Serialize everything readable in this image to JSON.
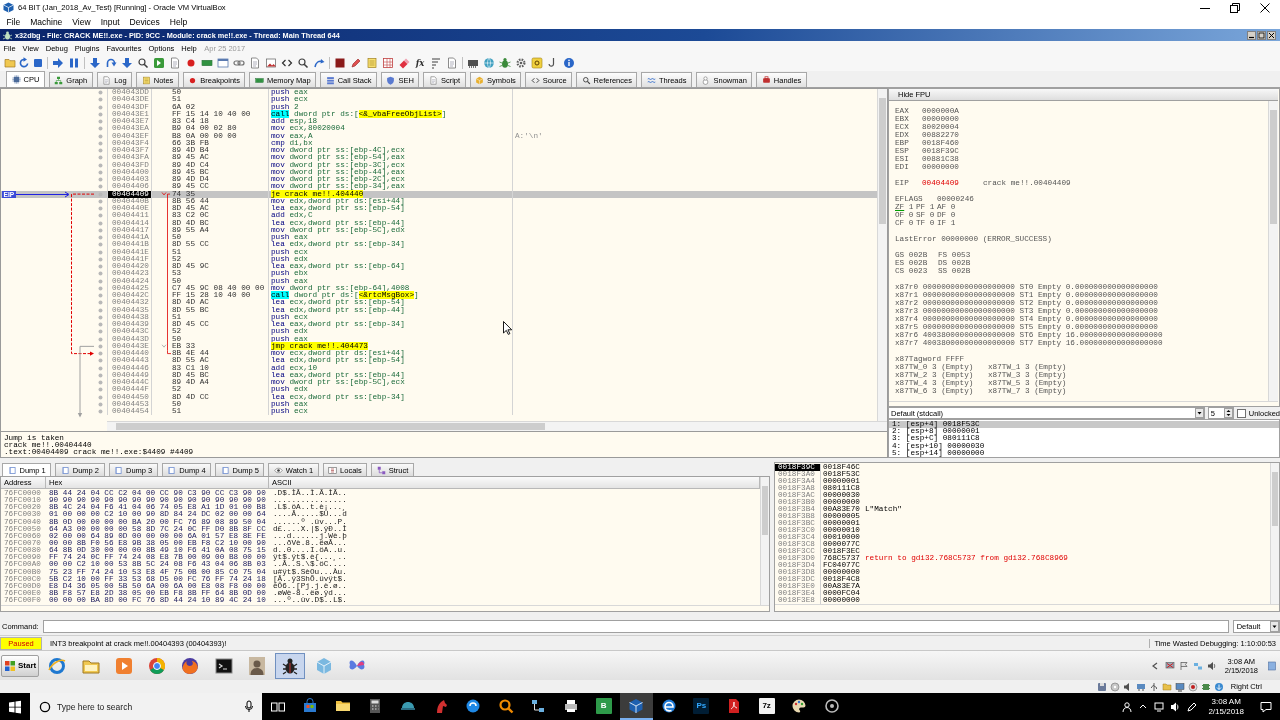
{
  "vbox": {
    "title": "64 BIT (Jan_2018_Av_Test) [Running] - Oracle VM VirtualBox",
    "menu": [
      "File",
      "Machine",
      "View",
      "Input",
      "Devices",
      "Help"
    ]
  },
  "debugger": {
    "title": "x32dbg - File: CRACK ME!!.exe - PID: 9CC - Module: crack me!!.exe - Thread: Main Thread 644",
    "menu": [
      "File",
      "View",
      "Debug",
      "Plugins",
      "Favourites",
      "Options",
      "Help"
    ],
    "build_date": "Apr 25 2017",
    "toolbar": {
      "text_buttons": [
        "fx"
      ]
    },
    "tabs": [
      {
        "label": "CPU",
        "selected": true
      },
      {
        "label": "Graph",
        "selected": false
      },
      {
        "label": "Log",
        "selected": false
      },
      {
        "label": "Notes",
        "selected": false
      },
      {
        "label": "Breakpoints",
        "selected": false
      },
      {
        "label": "Memory Map",
        "selected": false
      },
      {
        "label": "Call Stack",
        "selected": false
      },
      {
        "label": "SEH",
        "selected": false
      },
      {
        "label": "Script",
        "selected": false
      },
      {
        "label": "Symbols",
        "selected": false
      },
      {
        "label": "Source",
        "selected": false
      },
      {
        "label": "References",
        "selected": false
      },
      {
        "label": "Threads",
        "selected": false
      },
      {
        "label": "Snowman",
        "selected": false
      },
      {
        "label": "Handles",
        "selected": false
      }
    ],
    "disassembly": {
      "eip_label": "EIP",
      "rows": [
        {
          "address": "004043DD",
          "bytes": "50",
          "mnemonic": "push",
          "operands": "eax",
          "kind": "plain",
          "selected": false,
          "jump_target": false
        },
        {
          "address": "004043DE",
          "bytes": "51",
          "mnemonic": "push",
          "operands": "ecx",
          "kind": "plain",
          "selected": false,
          "jump_target": false
        },
        {
          "address": "004043DF",
          "bytes": "6A 02",
          "mnemonic": "push",
          "operands": "2",
          "kind": "plain",
          "selected": false,
          "jump_target": false
        },
        {
          "address": "004043E1",
          "bytes": "FF 15 14 10 40 00",
          "mnemonic": "call",
          "operands": "dword ptr ds:[",
          "target": "<&_vbaFreeObjList>",
          "operands_end": "]",
          "kind": "call",
          "selected": false,
          "jump_target": false
        },
        {
          "address": "004043E7",
          "bytes": "83 C4 18",
          "mnemonic": "add",
          "operands": "esp,18",
          "kind": "plain",
          "selected": false,
          "jump_target": false
        },
        {
          "address": "004043EA",
          "bytes": "B9 04 00 02 80",
          "mnemonic": "mov",
          "operands": "ecx,80020004",
          "kind": "plain",
          "selected": false,
          "jump_target": false
        },
        {
          "address": "004043EF",
          "bytes": "B8 0A 00 00 00",
          "mnemonic": "mov",
          "operands": "eax,A",
          "comment": "A:'\\n'",
          "kind": "plain",
          "selected": false,
          "jump_target": false
        },
        {
          "address": "004043F4",
          "bytes": "66 3B FB",
          "mnemonic": "cmp",
          "operands": "di,bx",
          "kind": "plain",
          "selected": false,
          "jump_target": false
        },
        {
          "address": "004043F7",
          "bytes": "89 4D B4",
          "mnemonic": "mov",
          "operands": "dword ptr ss:[ebp-4C],ecx",
          "kind": "plain",
          "selected": false,
          "jump_target": false
        },
        {
          "address": "004043FA",
          "bytes": "89 45 AC",
          "mnemonic": "mov",
          "operands": "dword ptr ss:[ebp-54],eax",
          "kind": "plain",
          "selected": false,
          "jump_target": false
        },
        {
          "address": "004043FD",
          "bytes": "89 4D C4",
          "mnemonic": "mov",
          "operands": "dword ptr ss:[ebp-3C],ecx",
          "kind": "plain",
          "selected": false,
          "jump_target": false
        },
        {
          "address": "00404400",
          "bytes": "89 45 BC",
          "mnemonic": "mov",
          "operands": "dword ptr ss:[ebp-44],eax",
          "kind": "plain",
          "selected": false,
          "jump_target": false
        },
        {
          "address": "00404403",
          "bytes": "89 4D D4",
          "mnemonic": "mov",
          "operands": "dword ptr ss:[ebp-2C],ecx",
          "kind": "plain",
          "selected": false,
          "jump_target": false
        },
        {
          "address": "00404406",
          "bytes": "89 45 CC",
          "mnemonic": "mov",
          "operands": "dword ptr ss:[ebp-34],eax",
          "kind": "plain",
          "selected": false,
          "jump_target": false
        },
        {
          "address": "00404409",
          "bytes": "74 35",
          "mnemonic": "je",
          "operands": "crack me!!.404440",
          "kind": "jump",
          "taken": true,
          "selected": true,
          "jump_target": false
        },
        {
          "address": "0040440B",
          "bytes": "8B 56 44",
          "mnemonic": "mov",
          "operands": "edx,dword ptr ds:[esi+44]",
          "kind": "plain",
          "selected": false,
          "jump_target": false
        },
        {
          "address": "0040440E",
          "bytes": "8D 45 AC",
          "mnemonic": "lea",
          "operands": "eax,dword ptr ss:[ebp-54]",
          "kind": "plain",
          "selected": false,
          "jump_target": false
        },
        {
          "address": "00404411",
          "bytes": "83 C2 0C",
          "mnemonic": "add",
          "operands": "edx,C",
          "kind": "plain",
          "selected": false,
          "jump_target": false
        },
        {
          "address": "00404414",
          "bytes": "8D 4D BC",
          "mnemonic": "lea",
          "operands": "ecx,dword ptr ss:[ebp-44]",
          "kind": "plain",
          "selected": false,
          "jump_target": false
        },
        {
          "address": "00404417",
          "bytes": "89 55 A4",
          "mnemonic": "mov",
          "operands": "dword ptr ss:[ebp-5C],edx",
          "kind": "plain",
          "selected": false,
          "jump_target": false
        },
        {
          "address": "0040441A",
          "bytes": "50",
          "mnemonic": "push",
          "operands": "eax",
          "kind": "plain",
          "selected": false,
          "jump_target": false
        },
        {
          "address": "0040441B",
          "bytes": "8D 55 CC",
          "mnemonic": "lea",
          "operands": "edx,dword ptr ss:[ebp-34]",
          "kind": "plain",
          "selected": false,
          "jump_target": false
        },
        {
          "address": "0040441E",
          "bytes": "51",
          "mnemonic": "push",
          "operands": "ecx",
          "kind": "plain",
          "selected": false,
          "jump_target": false
        },
        {
          "address": "0040441F",
          "bytes": "52",
          "mnemonic": "push",
          "operands": "edx",
          "kind": "plain",
          "selected": false,
          "jump_target": false
        },
        {
          "address": "00404420",
          "bytes": "8D 45 9C",
          "mnemonic": "lea",
          "operands": "eax,dword ptr ss:[ebp-64]",
          "kind": "plain",
          "selected": false,
          "jump_target": false
        },
        {
          "address": "00404423",
          "bytes": "53",
          "mnemonic": "push",
          "operands": "ebx",
          "kind": "plain",
          "selected": false,
          "jump_target": false
        },
        {
          "address": "00404424",
          "bytes": "50",
          "mnemonic": "push",
          "operands": "eax",
          "kind": "plain",
          "selected": false,
          "jump_target": false
        },
        {
          "address": "00404425",
          "bytes": "C7 45 9C 08 40 00 00",
          "mnemonic": "mov",
          "operands": "dword ptr ss:[ebp-64],4008",
          "kind": "plain",
          "selected": false,
          "jump_target": false
        },
        {
          "address": "0040442C",
          "bytes": "FF 15 28 10 40 00",
          "mnemonic": "call",
          "operands": "dword ptr ds:[",
          "target": "<&rtcMsgBox>",
          "operands_end": "]",
          "kind": "call",
          "selected": false,
          "jump_target": false
        },
        {
          "address": "00404432",
          "bytes": "8D 4D AC",
          "mnemonic": "lea",
          "operands": "ecx,dword ptr ss:[ebp-54]",
          "kind": "plain",
          "selected": false,
          "jump_target": false
        },
        {
          "address": "00404435",
          "bytes": "8D 55 BC",
          "mnemonic": "lea",
          "operands": "edx,dword ptr ss:[ebp-44]",
          "kind": "plain",
          "selected": false,
          "jump_target": false
        },
        {
          "address": "00404438",
          "bytes": "51",
          "mnemonic": "push",
          "operands": "ecx",
          "kind": "plain",
          "selected": false,
          "jump_target": false
        },
        {
          "address": "00404439",
          "bytes": "8D 45 CC",
          "mnemonic": "lea",
          "operands": "eax,dword ptr ss:[ebp-34]",
          "kind": "plain",
          "selected": false,
          "jump_target": false
        },
        {
          "address": "0040443C",
          "bytes": "52",
          "mnemonic": "push",
          "operands": "edx",
          "kind": "plain",
          "selected": false,
          "jump_target": false
        },
        {
          "address": "0040443D",
          "bytes": "50",
          "mnemonic": "push",
          "operands": "eax",
          "kind": "plain",
          "selected": false,
          "jump_target": false
        },
        {
          "address": "0040443E",
          "bytes": "EB 33",
          "mnemonic": "jmp",
          "operands": "crack me!!.404473",
          "kind": "jump",
          "taken": false,
          "selected": false,
          "jump_target": false
        },
        {
          "address": "00404440",
          "bytes": "8B 4E 44",
          "mnemonic": "mov",
          "operands": "ecx,dword ptr ds:[esi+44]",
          "kind": "plain",
          "selected": false,
          "jump_target": true
        },
        {
          "address": "00404443",
          "bytes": "8D 55 AC",
          "mnemonic": "lea",
          "operands": "edx,dword ptr ss:[ebp-54]",
          "kind": "plain",
          "selected": false,
          "jump_target": false
        },
        {
          "address": "00404446",
          "bytes": "83 C1 10",
          "mnemonic": "add",
          "operands": "ecx,10",
          "kind": "plain",
          "selected": false,
          "jump_target": false
        },
        {
          "address": "00404449",
          "bytes": "8D 45 BC",
          "mnemonic": "lea",
          "operands": "eax,dword ptr ss:[ebp-44]",
          "kind": "plain",
          "selected": false,
          "jump_target": false
        },
        {
          "address": "0040444C",
          "bytes": "89 4D A4",
          "mnemonic": "mov",
          "operands": "dword ptr ss:[ebp-5C],ecx",
          "kind": "plain",
          "selected": false,
          "jump_target": false
        },
        {
          "address": "0040444F",
          "bytes": "52",
          "mnemonic": "push",
          "operands": "edx",
          "kind": "plain",
          "selected": false,
          "jump_target": false
        },
        {
          "address": "00404450",
          "bytes": "8D 4D CC",
          "mnemonic": "lea",
          "operands": "ecx,dword ptr ss:[ebp-34]",
          "kind": "plain",
          "selected": false,
          "jump_target": false
        },
        {
          "address": "00404453",
          "bytes": "50",
          "mnemonic": "push",
          "operands": "eax",
          "kind": "plain",
          "selected": false,
          "jump_target": false
        },
        {
          "address": "00404454",
          "bytes": "51",
          "mnemonic": "push",
          "operands": "ecx",
          "kind": "plain",
          "selected": false,
          "jump_target": false
        }
      ]
    },
    "jump_info": [
      "Jump is taken",
      "crack me!!.00404440",
      ".text:00404409 crack me!!.exe:$4409 #4409"
    ],
    "registers": {
      "header": "Hide FPU",
      "general": [
        {
          "name": "EAX",
          "value": "0000000A",
          "changed": false
        },
        {
          "name": "EBX",
          "value": "00000000",
          "changed": false
        },
        {
          "name": "ECX",
          "value": "80020004",
          "changed": false
        },
        {
          "name": "EDX",
          "value": "00882270",
          "changed": false
        },
        {
          "name": "EBP",
          "value": "0018F460",
          "changed": false
        },
        {
          "name": "ESP",
          "value": "0018F39C",
          "changed": false
        },
        {
          "name": "ESI",
          "value": "00881C38",
          "changed": false
        },
        {
          "name": "EDI",
          "value": "00000000",
          "changed": false
        }
      ],
      "eip": {
        "name": "EIP",
        "value": "00404409",
        "changed": true,
        "comment": "crack me!!.00404409"
      },
      "eflags": {
        "name": "EFLAGS",
        "value": "00000246"
      },
      "flag_rows": [
        {
          "flags": [
            {
              "name": "ZF",
              "value": "1",
              "highlighted": true
            },
            {
              "name": "PF",
              "value": "1",
              "highlighted": false
            },
            {
              "name": "AF",
              "value": "0",
              "highlighted": false
            }
          ]
        },
        {
          "flags": [
            {
              "name": "OF",
              "value": "0",
              "highlighted": false
            },
            {
              "name": "SF",
              "value": "0",
              "highlighted": false
            },
            {
              "name": "DF",
              "value": "0",
              "highlighted": false
            }
          ]
        },
        {
          "flags": [
            {
              "name": "CF",
              "value": "0",
              "highlighted": false
            },
            {
              "name": "TF",
              "value": "0",
              "highlighted": false
            },
            {
              "name": "IF",
              "value": "1",
              "highlighted": false
            }
          ]
        }
      ],
      "last_error": "LastError 00000000 (ERROR_SUCCESS)",
      "segment_rows": [
        {
          "segments": [
            {
              "name": "GS",
              "value": "002B"
            },
            {
              "name": "FS",
              "value": "0053"
            }
          ]
        },
        {
          "segments": [
            {
              "name": "ES",
              "value": "002B"
            },
            {
              "name": "DS",
              "value": "002B"
            }
          ]
        },
        {
          "segments": [
            {
              "name": "CS",
              "value": "0023"
            },
            {
              "name": "SS",
              "value": "002B"
            }
          ]
        }
      ],
      "fpu": [
        "x87r0 00000000000000000000 ST0 Empty 0.000000000000000000",
        "x87r1 00000000000000000000 ST1 Empty 0.000000000000000000",
        "x87r2 00000000000000000000 ST2 Empty 0.000000000000000000",
        "x87r3 00000000000000000000 ST3 Empty 0.000000000000000000",
        "x87r4 00000000000000000000 ST4 Empty 0.000000000000000000",
        "x87r5 00000000000000000000 ST5 Empty 0.000000000000000000",
        "x87r6 40038000000000000000 ST6 Empty 16.000000000000000000",
        "x87r7 40038000000000000000 ST7 Empty 16.000000000000000000"
      ],
      "tagword": "x87Tagword FFFF",
      "tag_rows": [
        {
          "tags": [
            "x87TW_0 3 (Empty)",
            "x87TW_1 3 (Empty)"
          ]
        },
        {
          "tags": [
            "x87TW_2 3 (Empty)",
            "x87TW_3 3 (Empty)"
          ]
        },
        {
          "tags": [
            "x87TW_4 3 (Empty)",
            "x87TW_5 3 (Empty)"
          ]
        },
        {
          "tags": [
            "x87TW_6 3 (Empty)",
            "x87TW_7 3 (Empty)"
          ]
        }
      ]
    },
    "arguments": {
      "convention": "Default (stdcall)",
      "count": "5",
      "unlocked": {
        "label": "Unlocked",
        "checked": false
      },
      "rows": [
        {
          "text": "1: [esp+4] 0018F53C",
          "selected": true
        },
        {
          "text": "2: [esp+8] 00000001",
          "selected": false
        },
        {
          "text": "3: [esp+C] 080111C8",
          "selected": false
        },
        {
          "text": "4: [esp+10] 00000030",
          "selected": false
        },
        {
          "text": "5: [esp+14] 00000000",
          "selected": false
        }
      ]
    },
    "dump": {
      "tabs": [
        {
          "label": "Dump 1",
          "selected": true
        },
        {
          "label": "Dump 2",
          "selected": false
        },
        {
          "label": "Dump 3",
          "selected": false
        },
        {
          "label": "Dump 4",
          "selected": false
        },
        {
          "label": "Dump 5",
          "selected": false
        },
        {
          "label": "Watch 1",
          "selected": false
        },
        {
          "label": "Locals",
          "selected": false
        },
        {
          "label": "Struct",
          "selected": false
        }
      ],
      "columns": [
        "Address",
        "Hex",
        "ASCII"
      ],
      "rows": [
        {
          "address": "76FC0000",
          "hex": "8B 44 24 04 CC C2 04 00 CC 90 C3 90 CC C3 90 90",
          "ascii": ".D$.ÌÂ..Ì.Ã.ÌÃ.."
        },
        {
          "address": "76FC0010",
          "hex": "90 90 90 90 90 90 90 90 90 90 90 90 90 90 90 90",
          "ascii": "................"
        },
        {
          "address": "76FC0020",
          "hex": "8B 4C 24 04 F6 41 04 06 74 05 E8 A1 1D 01 00 B8",
          "ascii": ".L$.öA..t.è¡...¸"
        },
        {
          "address": "76FC0030",
          "hex": "01 00 00 00 C2 10 00 90 8D 84 24 DC 02 00 00 64",
          "ascii": "....Â.....$Ü...d"
        },
        {
          "address": "76FC0040",
          "hex": "8B 0D 00 00 00 00 BA 20 00 FC 76 89 08 89 50 04",
          "ascii": "......º .üv...P."
        },
        {
          "address": "76FC0050",
          "hex": "64 A3 00 00 00 00 58 8D 7C 24 0C FF D0 8B 8F CC",
          "ascii": "d£....X.|$.ÿÐ..Ì"
        },
        {
          "address": "76FC0060",
          "hex": "02 00 00 64 89 0D 00 00 00 00 6A 01 57 E8 8E FE",
          "ascii": "...d......j.Wè.þ"
        },
        {
          "address": "76FC0070",
          "hex": "00 00 8B F0 56 E8 9B 38 05 00 EB F8 C2 10 00 90",
          "ascii": "...ðVè.8..ëøÂ..."
        },
        {
          "address": "76FC0080",
          "hex": "64 8B 0D 30 00 00 00 8B 49 10 F6 41 0A 08 75 15",
          "ascii": "d..0....I.öA..u."
        },
        {
          "address": "76FC0090",
          "hex": "FF 74 24 0C FF 74 24 08 E8 7B 00 09 00 B8 00 00",
          "ascii": "ÿt$.ÿt$.è{...¸.."
        },
        {
          "address": "76FC00A0",
          "hex": "00 00 C2 10 00 53 8B 5C 24 08 F6 43 04 06 8B 03",
          "ascii": "..Â..S.\\$.öC...."
        },
        {
          "address": "76FC00B0",
          "hex": "75 23 FF 74 24 10 53 E8 4F 75 0B 00 85 C0 75 04",
          "ascii": "u#ÿt$.SèOu...Àu."
        },
        {
          "address": "76FC00C0",
          "hex": "5B C2 10 00 FF 33 53 68 D5 00 FC 76 FF 74 24 18",
          "ascii": "[Â..ÿ3ShÕ.üvÿt$."
        },
        {
          "address": "76FC00D0",
          "hex": "E8 D4 36 05 00 5B 50 6A 00 6A 00 E8 08 F8 00 00",
          "ascii": "èÔ6..[Pj.j.è.ø.."
        },
        {
          "address": "76FC00E0",
          "hex": "8B F8 57 E8 2D 38 05 00 EB F8 8B FF 64 8B 0D 00",
          "ascii": ".øWè-8..ëø.ÿd..."
        },
        {
          "address": "76FC00F0",
          "hex": "00 00 00 BA 8D 00 FC 76 8D 44 24 10 89 4C 24 10",
          "ascii": "...º..üv.D$..L$."
        }
      ]
    },
    "stack": {
      "rows": [
        {
          "address": "0018F39C",
          "value": "0018F46C",
          "selected": true
        },
        {
          "address": "0018F3A0",
          "value": "0018F53C",
          "selected": false
        },
        {
          "address": "0018F3A4",
          "value": "00000001",
          "selected": false
        },
        {
          "address": "0018F3A8",
          "value": "080111C8",
          "selected": false
        },
        {
          "address": "0018F3AC",
          "value": "00000030",
          "selected": false
        },
        {
          "address": "0018F3B0",
          "value": "00000000",
          "selected": false
        },
        {
          "address": "0018F3B4",
          "value": "00A83E70",
          "selected": false,
          "comment": {
            "text": "L\"Match\"",
            "kind": "string"
          }
        },
        {
          "address": "0018F3B8",
          "value": "00000005",
          "selected": false
        },
        {
          "address": "0018F3BC",
          "value": "00000001",
          "selected": false
        },
        {
          "address": "0018F3C0",
          "value": "00000010",
          "selected": false
        },
        {
          "address": "0018F3C4",
          "value": "00010000",
          "selected": false
        },
        {
          "address": "0018F3C8",
          "value": "0000077C",
          "selected": false
        },
        {
          "address": "0018F3CC",
          "value": "0018F3EC",
          "selected": false
        },
        {
          "address": "0018F3D0",
          "value": "768C5737",
          "selected": false,
          "comment": {
            "text": "return to gdi32.768C5737 from gdi32.768C8969",
            "kind": "return"
          }
        },
        {
          "address": "0018F3D4",
          "value": "FC04077C",
          "selected": false
        },
        {
          "address": "0018F3D8",
          "value": "00000000",
          "selected": false
        },
        {
          "address": "0018F3DC",
          "value": "0018F4C8",
          "selected": false
        },
        {
          "address": "0018F3E0",
          "value": "00A83E7A",
          "selected": false
        },
        {
          "address": "0018F3E4",
          "value": "0000FC04",
          "selected": false
        },
        {
          "address": "0018F3E8",
          "value": "00000000",
          "selected": false
        }
      ]
    },
    "command": {
      "label": "Command:",
      "mode": "Default"
    },
    "status": {
      "state": "Paused",
      "message": "INT3 breakpoint at crack me!!.00404393 (00404393)!",
      "timer": "Time Wasted Debugging: 1:10:00:53"
    }
  },
  "guest_taskbar": {
    "start": "Start",
    "apps": [
      {
        "active": false
      },
      {
        "active": false
      },
      {
        "active": false
      },
      {
        "active": false
      },
      {
        "active": false
      },
      {
        "active": false
      },
      {
        "active": false
      },
      {
        "active": true
      },
      {
        "active": false
      },
      {
        "active": false
      }
    ],
    "time": "3:08 AM",
    "date": "2/15/2018"
  },
  "vbox_status": {
    "host_key": "Right Ctrl"
  },
  "host_taskbar": {
    "search": {
      "placeholder": "Type here to search"
    },
    "apps": [
      {
        "active": false
      },
      {
        "active": false
      },
      {
        "active": false
      },
      {
        "active": false
      },
      {
        "active": false
      },
      {
        "active": false
      },
      {
        "active": false
      },
      {
        "active": false
      },
      {
        "active": false
      },
      {
        "active": false,
        "label": "B"
      },
      {
        "active": true
      },
      {
        "active": false
      },
      {
        "active": false,
        "label": "Ps"
      },
      {
        "active": false
      },
      {
        "active": false,
        "label": "7z"
      },
      {
        "active": false
      },
      {
        "active": false
      }
    ],
    "time": "3:08 AM",
    "date": "2/15/2018"
  }
}
